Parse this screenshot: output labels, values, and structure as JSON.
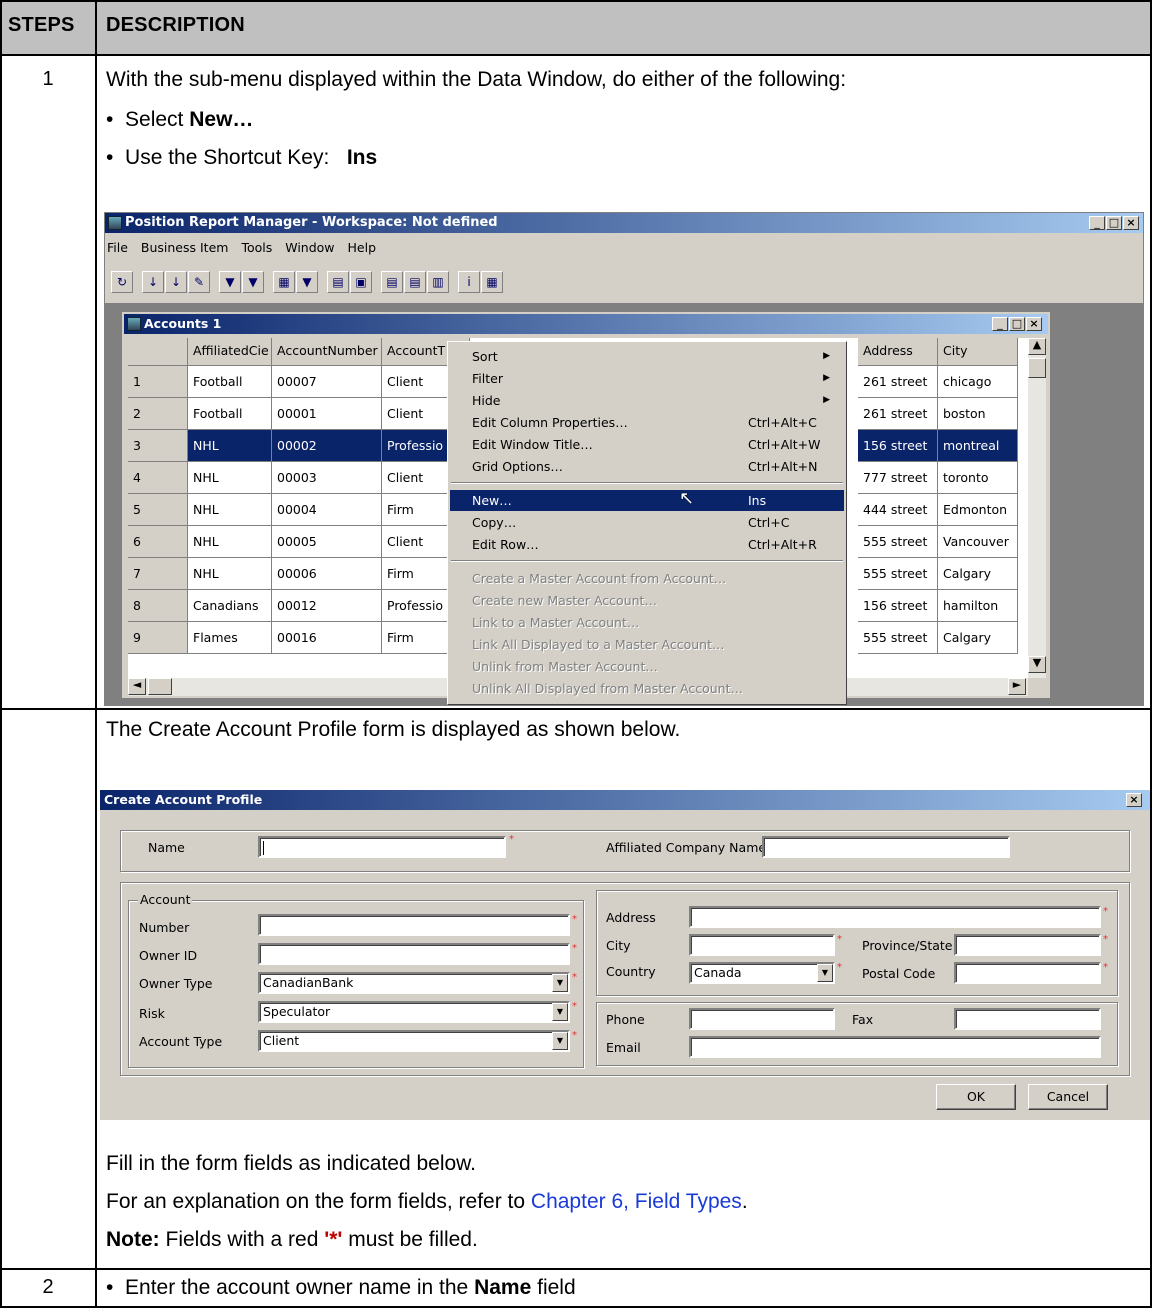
{
  "table": {
    "header_steps": "STEPS",
    "header_desc": "DESCRIPTION",
    "rows": [
      {
        "step": "1",
        "intro": "With the sub-menu displayed within the Data Window, do either of the following:",
        "bullet1_pre": "Select ",
        "bullet1_bold": "New…",
        "bullet2_pre": "Use the Shortcut Key:   ",
        "bullet2_bold": "Ins"
      },
      {
        "step": "",
        "intro": "The Create Account Profile form is displayed as shown below.",
        "fill": "Fill in the form fields as indicated below.",
        "explain_pre": "For an explanation on the form fields, refer to ",
        "explain_link": "Chapter 6, Field Types",
        "explain_post": ".",
        "note_bold": "Note:",
        "note_pre": " Fields with a red ",
        "note_star": "'*'",
        "note_post": " must be filled."
      },
      {
        "step": "2",
        "bullet_pre": "Enter the account owner name in the ",
        "bullet_bold": "Name",
        "bullet_post": " field"
      }
    ]
  },
  "app": {
    "title": "Position Report Manager - Workspace: Not defined",
    "menu": [
      "File",
      "Business Item",
      "Tools",
      "Window",
      "Help"
    ],
    "toolbar_icons": [
      "refresh-icon",
      "sort-asc-icon",
      "sort-desc-icon",
      "clear-sort-icon",
      "filter-icon",
      "clear-filter-icon",
      "hide-icon",
      "unhide-icon",
      "print-icon",
      "find-icon",
      "tile-icon",
      "horizontal-icon",
      "vertical-icon",
      "info-icon",
      "grid-icon"
    ],
    "toolbar_glyphs": [
      "↻",
      "↓",
      "↓",
      "✎",
      "▼",
      "▼",
      "▦",
      "▼",
      "▤",
      "▣",
      "▤",
      "▤",
      "▥",
      "i",
      "▦"
    ]
  },
  "accounts": {
    "title": "Accounts 1",
    "columns": [
      "",
      "AffiliatedCie",
      "AccountNumber",
      "AccountT",
      "Address",
      "City"
    ],
    "rows": [
      [
        "1",
        "Football",
        "00007",
        "Client",
        "261 street",
        "chicago"
      ],
      [
        "2",
        "Football",
        "00001",
        "Client",
        "261 street",
        "boston"
      ],
      [
        "3",
        "NHL",
        "00002",
        "Professio",
        "156 street",
        "montreal"
      ],
      [
        "4",
        "NHL",
        "00003",
        "Client",
        "777 street",
        "toronto"
      ],
      [
        "5",
        "NHL",
        "00004",
        "Firm",
        "444 street",
        "Edmonton"
      ],
      [
        "6",
        "NHL",
        "00005",
        "Client",
        "555 street",
        "Vancouver"
      ],
      [
        "7",
        "NHL",
        "00006",
        "Firm",
        "555 street",
        "Calgary"
      ],
      [
        "8",
        "Canadians",
        "00012",
        "Professio",
        "156 street",
        "hamilton"
      ],
      [
        "9",
        "Flames",
        "00016",
        "Firm",
        "555 street",
        "Calgary"
      ]
    ],
    "selected_row": 2
  },
  "context_menu": {
    "items": [
      {
        "label": "Sort",
        "shortcut": "",
        "submenu": true,
        "disabled": false
      },
      {
        "label": "Filter",
        "shortcut": "",
        "submenu": true,
        "disabled": false
      },
      {
        "label": "Hide",
        "shortcut": "",
        "submenu": true,
        "disabled": false
      },
      {
        "label": "Edit Column Properties…",
        "shortcut": "Ctrl+Alt+C",
        "submenu": false,
        "disabled": false
      },
      {
        "label": "Edit Window Title…",
        "shortcut": "Ctrl+Alt+W",
        "submenu": false,
        "disabled": false
      },
      {
        "label": "Grid Options…",
        "shortcut": "Ctrl+Alt+N",
        "submenu": false,
        "disabled": false
      },
      {
        "label": "New…",
        "shortcut": "Ins",
        "submenu": false,
        "disabled": false,
        "highlighted": true
      },
      {
        "label": "Copy…",
        "shortcut": "Ctrl+C",
        "submenu": false,
        "disabled": false
      },
      {
        "label": "Edit Row…",
        "shortcut": "Ctrl+Alt+R",
        "submenu": false,
        "disabled": false
      },
      {
        "label": "Create a Master Account from Account…",
        "shortcut": "",
        "submenu": false,
        "disabled": true
      },
      {
        "label": "Create new Master Account…",
        "shortcut": "",
        "submenu": false,
        "disabled": true
      },
      {
        "label": "Link to a Master Account…",
        "shortcut": "",
        "submenu": false,
        "disabled": true
      },
      {
        "label": "Link All Displayed to a Master Account…",
        "shortcut": "",
        "submenu": false,
        "disabled": true
      },
      {
        "label": "Unlink from Master Account…",
        "shortcut": "",
        "submenu": false,
        "disabled": true
      },
      {
        "label": "Unlink All Displayed from Master Account…",
        "shortcut": "",
        "submenu": false,
        "disabled": true
      }
    ]
  },
  "form": {
    "title": "Create Account Profile",
    "name_label": "Name",
    "affiliated_label": "Affiliated Company Name",
    "account_group": "Account",
    "number_label": "Number",
    "owner_id_label": "Owner ID",
    "owner_type_label": "Owner Type",
    "owner_type_value": "CanadianBank",
    "risk_label": "Risk",
    "risk_value": "Speculator",
    "account_type_label": "Account Type",
    "account_type_value": "Client",
    "address_label": "Address",
    "city_label": "City",
    "province_label": "Province/State",
    "country_label": "Country",
    "country_value": "Canada",
    "postal_label": "Postal Code",
    "phone_label": "Phone",
    "fax_label": "Fax",
    "email_label": "Email",
    "ok_label": "OK",
    "cancel_label": "Cancel",
    "required_mark": "*"
  }
}
